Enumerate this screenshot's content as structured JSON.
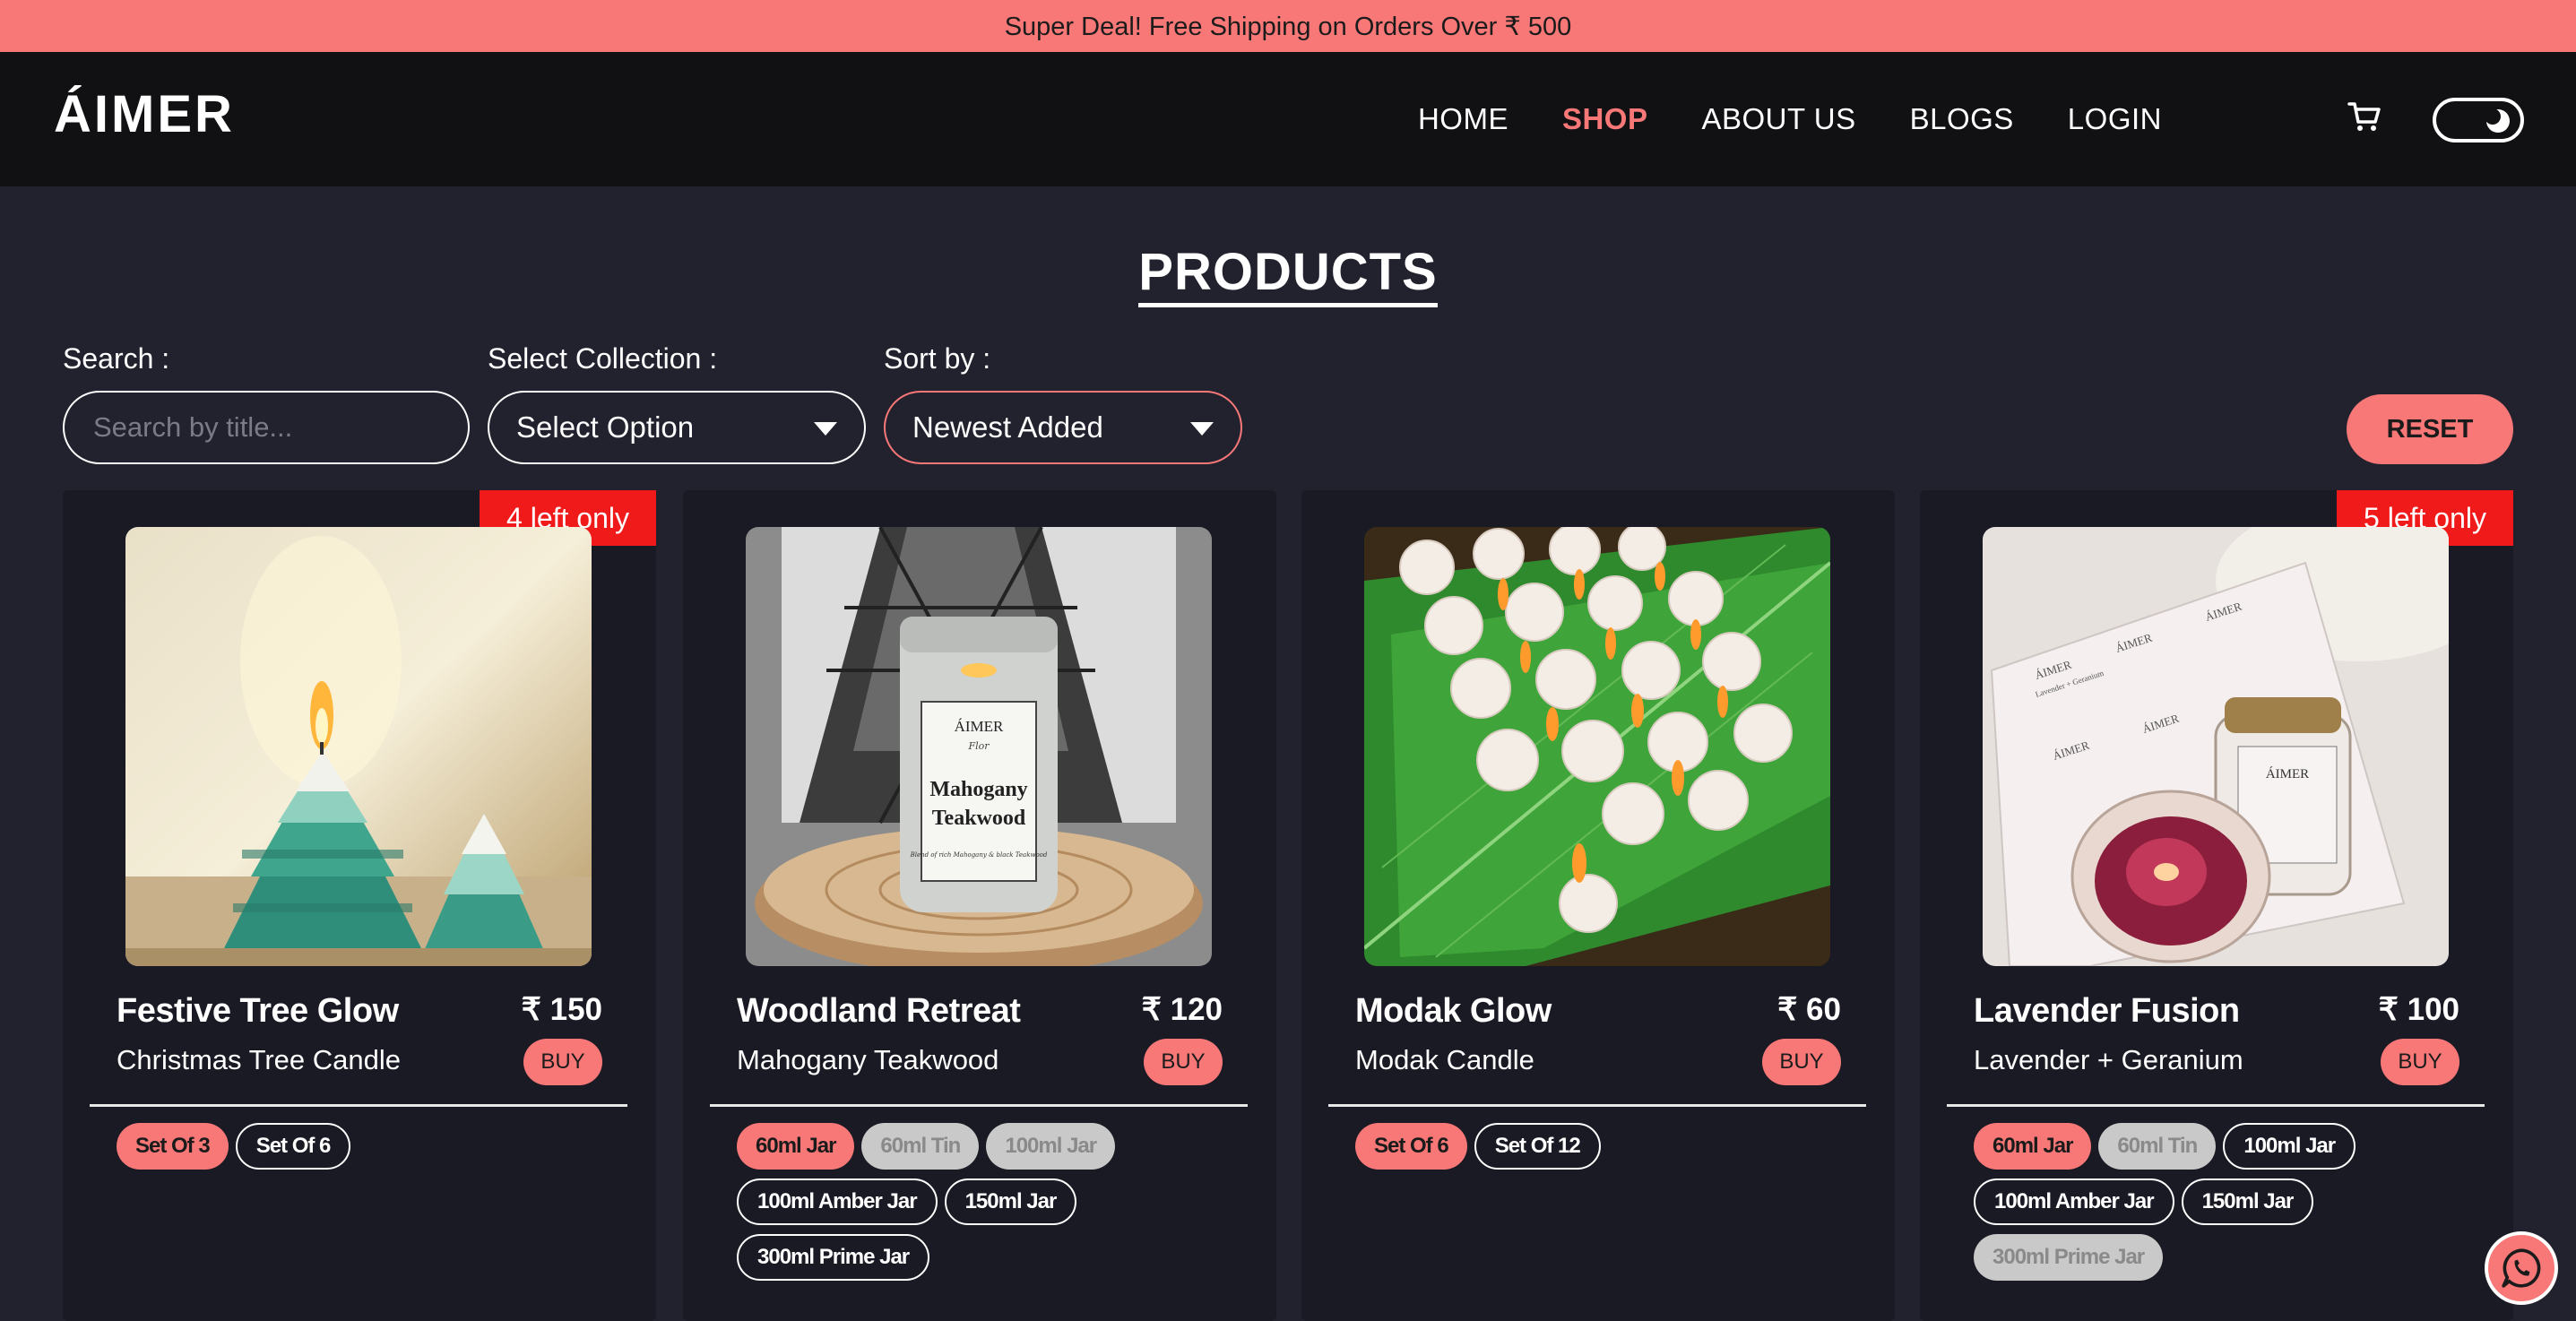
{
  "promo": {
    "text": "Super Deal! Free Shipping on Orders Over ₹ 500"
  },
  "header": {
    "logo": "ÁIMER",
    "nav": [
      {
        "label": "HOME",
        "active": false
      },
      {
        "label": "SHOP",
        "active": true
      },
      {
        "label": "ABOUT US",
        "active": false
      },
      {
        "label": "BLOGS",
        "active": false
      },
      {
        "label": "LOGIN",
        "active": false
      }
    ],
    "cart_icon": "cart-icon",
    "theme_toggle_icon": "moon-icon"
  },
  "page": {
    "title": "PRODUCTS"
  },
  "filters": {
    "search_label": "Search :",
    "search_placeholder": "Search by title...",
    "collection_label": "Select Collection :",
    "collection_value": "Select Option",
    "sort_label": "Sort by :",
    "sort_value": "Newest Added",
    "reset_label": "RESET"
  },
  "products": [
    {
      "badge": "4 left only",
      "title": "Festive Tree Glow",
      "price": "₹ 150",
      "subtitle": "Christmas Tree Candle",
      "buy_label": "BUY",
      "variants": [
        {
          "label": "Set Of 3",
          "state": "selected"
        },
        {
          "label": "Set Of 6",
          "state": "normal"
        }
      ]
    },
    {
      "badge": "",
      "title": "Woodland Retreat",
      "price": "₹ 120",
      "subtitle": "Mahogany Teakwood",
      "buy_label": "BUY",
      "jar_label": {
        "brand": "ÁIMER",
        "script": "Flor",
        "name1": "Mahogany",
        "name2": "Teakwood",
        "tagline": "Blend of rich Mahogany & black Teakwood"
      },
      "variants": [
        {
          "label": "60ml Jar",
          "state": "selected"
        },
        {
          "label": "60ml Tin",
          "state": "disabled"
        },
        {
          "label": "100ml Jar",
          "state": "disabled"
        },
        {
          "label": "100ml Amber Jar",
          "state": "normal"
        },
        {
          "label": "150ml Jar",
          "state": "normal"
        },
        {
          "label": "300ml Prime Jar",
          "state": "normal"
        }
      ]
    },
    {
      "badge": "",
      "title": "Modak Glow",
      "price": "₹ 60",
      "subtitle": "Modak Candle",
      "buy_label": "BUY",
      "variants": [
        {
          "label": "Set Of 6",
          "state": "selected"
        },
        {
          "label": "Set Of 12",
          "state": "normal"
        }
      ]
    },
    {
      "badge": "5 left only",
      "title": "Lavender Fusion",
      "price": "₹ 100",
      "subtitle": "Lavender + Geranium",
      "buy_label": "BUY",
      "jar_label": {
        "brand": "ÁIMER",
        "name": "Lavender + Geranium"
      },
      "variants": [
        {
          "label": "60ml Jar",
          "state": "selected"
        },
        {
          "label": "60ml Tin",
          "state": "disabled"
        },
        {
          "label": "100ml Jar",
          "state": "normal"
        },
        {
          "label": "100ml Amber Jar",
          "state": "normal"
        },
        {
          "label": "150ml Jar",
          "state": "normal"
        },
        {
          "label": "300ml Prime Jar",
          "state": "disabled"
        }
      ]
    }
  ],
  "chat": {
    "icon": "whatsapp-icon"
  },
  "colors": {
    "accent": "#f87878",
    "page_bg": "#22222f",
    "card_bg": "#1a1a24",
    "nav_bg": "#111114",
    "badge": "#f01a1a"
  }
}
